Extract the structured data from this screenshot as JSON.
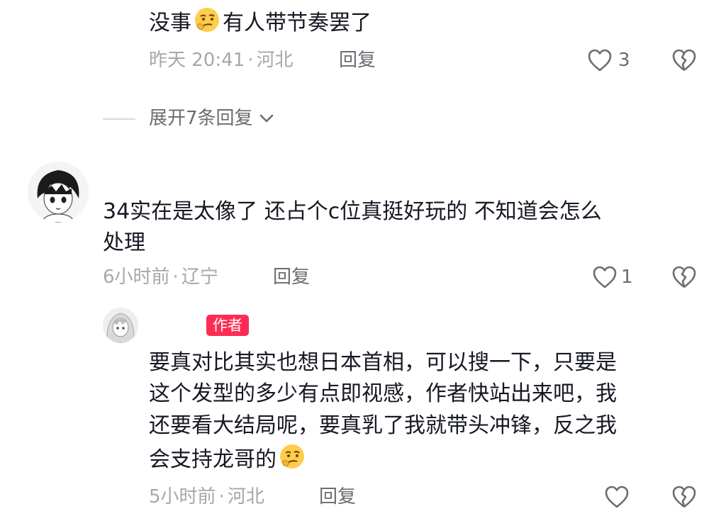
{
  "comments": [
    {
      "text_before": "没事",
      "text_after": "有人带节奏罢了",
      "emoji": "thinking-emoji",
      "time": "昨天 20:41",
      "location": "河北",
      "reply_label": "回复",
      "likes": "3"
    },
    {
      "username": "",
      "line1": "34实在是太像了 还占个c位真挺好玩的 不知道会怎么",
      "line2": "处理",
      "time": "6小时前",
      "location": "辽宁",
      "reply_label": "回复",
      "likes": "1"
    },
    {
      "username": "",
      "author_badge": "作者",
      "line1": "要真对比其实也想日本首相，可以搜一下，只要是",
      "line2": "这个发型的多少有点即视感，作者快站出来吧，我",
      "line3": "还要看大结局呢，要真乳了我就带头冲锋，反之我",
      "line4": "会支持龙哥的",
      "emoji": "thinking-emoji",
      "time": "5小时前",
      "location": "河北",
      "reply_label": "回复",
      "likes": ""
    }
  ],
  "expand": {
    "label": "展开7条回复",
    "icon": "chevron-down-icon"
  },
  "separator": "·",
  "colors": {
    "primary_text": "#161823",
    "secondary_text": "#a6a7ab",
    "action_text": "#6b6c72",
    "author_badge": "#fe2c55"
  }
}
